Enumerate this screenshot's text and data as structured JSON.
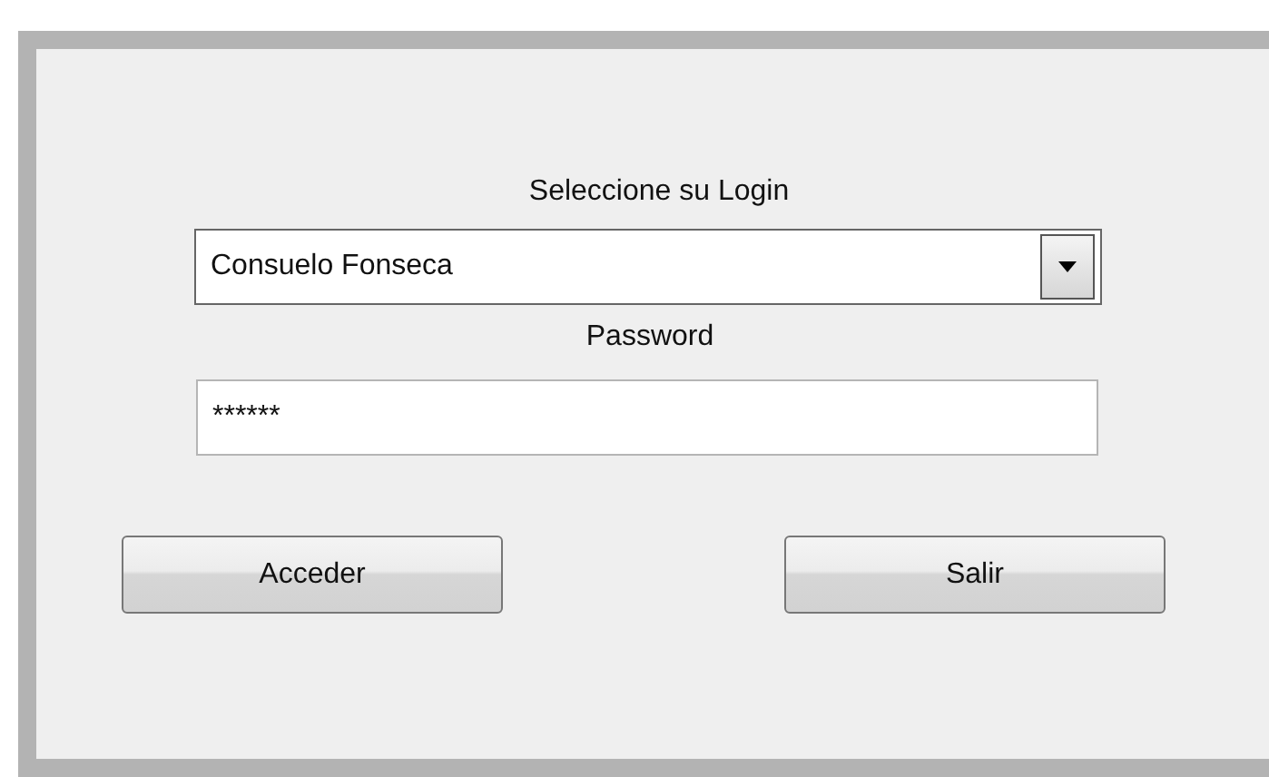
{
  "title": "Seleccione su Login",
  "login_select": {
    "value": "Consuelo Fonseca"
  },
  "password_label": "Password",
  "password_field": {
    "value": "******"
  },
  "buttons": [
    {
      "label": "Acceder"
    },
    {
      "label": "Salir"
    }
  ]
}
